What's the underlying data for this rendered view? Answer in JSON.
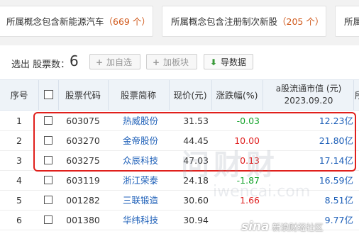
{
  "concept_tags": [
    {
      "text": "所属概念包含新能源汽车",
      "count": "（669 个）"
    },
    {
      "text": "所属概念包含注册制次新股",
      "count": "（205 个）"
    },
    {
      "text": "所属",
      "count": ""
    }
  ],
  "toolbar": {
    "selected_label": "选出 股票数：",
    "selected_count": "6",
    "add_watchlist": "加自选",
    "add_plate": "加板块",
    "export": "导数据"
  },
  "table": {
    "headers": {
      "idx": "序号",
      "code": "股票代码",
      "name": "股票简称",
      "price": "现价(元)",
      "change": "涨跌幅(%)",
      "mv_title": "a股流通市值 (元)",
      "mv_date": "2023.09.20",
      "extra": "所"
    },
    "rows": [
      {
        "idx": "1",
        "code": "603075",
        "name": "热威股份",
        "price": "31.53",
        "change": "-0.03",
        "dir": "down",
        "mv": "12.23亿"
      },
      {
        "idx": "2",
        "code": "603270",
        "name": "金帝股份",
        "price": "44.45",
        "change": "10.00",
        "dir": "up",
        "mv": "21.80亿"
      },
      {
        "idx": "3",
        "code": "603275",
        "name": "众辰科技",
        "price": "47.03",
        "change": "0.13",
        "dir": "up",
        "mv": "17.14亿"
      },
      {
        "idx": "4",
        "code": "603119",
        "name": "浙江荣泰",
        "price": "24.18",
        "change": "-1.87",
        "dir": "down",
        "mv": "16.59亿"
      },
      {
        "idx": "5",
        "code": "001282",
        "name": "三联锻造",
        "price": "30.60",
        "change": "1.66",
        "dir": "up",
        "mv": "8.51亿"
      },
      {
        "idx": "6",
        "code": "001380",
        "name": "华纬科技",
        "price": "30.94",
        "change": "",
        "dir": "up",
        "mv": "9.77亿"
      }
    ]
  },
  "watermark": {
    "main": "问财财",
    "sub": "iwencai.com",
    "sina": "sina",
    "sina_text": "新浪财经社区"
  },
  "colors": {
    "up": "#e02020",
    "down": "#13a32a",
    "link": "#1d5fb8",
    "highlight": "#e0201c"
  }
}
